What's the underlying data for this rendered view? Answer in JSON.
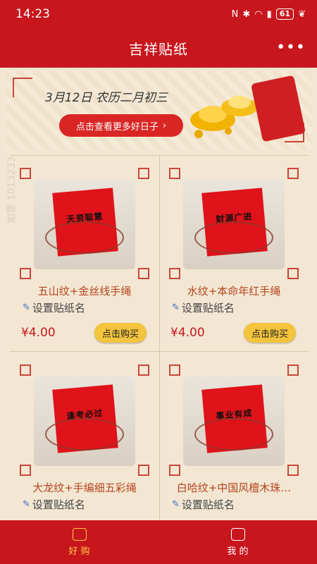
{
  "status_bar": {
    "time": "14:23",
    "battery": "61"
  },
  "header": {
    "title": "吉祥贴纸",
    "more_icon": "more-dots-icon"
  },
  "banner": {
    "date_text": "3月12日 农历二月初三",
    "cta_label": "点击查看更多好日子",
    "cta_arrow": "›"
  },
  "products": [
    {
      "name": "五山纹+金丝线手绳",
      "set_name": "设置贴纸名",
      "price": "¥4.00",
      "buy_label": "点击购买",
      "sticker_text": "天资聪慧"
    },
    {
      "name": "水纹+本命年红手绳",
      "set_name": "设置贴纸名",
      "price": "¥4.00",
      "buy_label": "点击购买",
      "sticker_text": "财源广进"
    },
    {
      "name": "大龙纹+手编细五彩绳",
      "set_name": "设置贴纸名",
      "price": "",
      "buy_label": "",
      "sticker_text": "逢考必过"
    },
    {
      "name": "白哈纹+中国风檀木珠…",
      "set_name": "设置贴纸名",
      "price": "",
      "buy_label": "",
      "sticker_text": "事业有成"
    }
  ],
  "tabs": [
    {
      "label": "好 购",
      "active": true
    },
    {
      "label": "我 的",
      "active": false
    }
  ],
  "watermark": "如意 1013233",
  "colors": {
    "primary_red": "#c8161d",
    "accent_yellow": "#ffcc4a",
    "buy_button": "#f3c43c"
  }
}
